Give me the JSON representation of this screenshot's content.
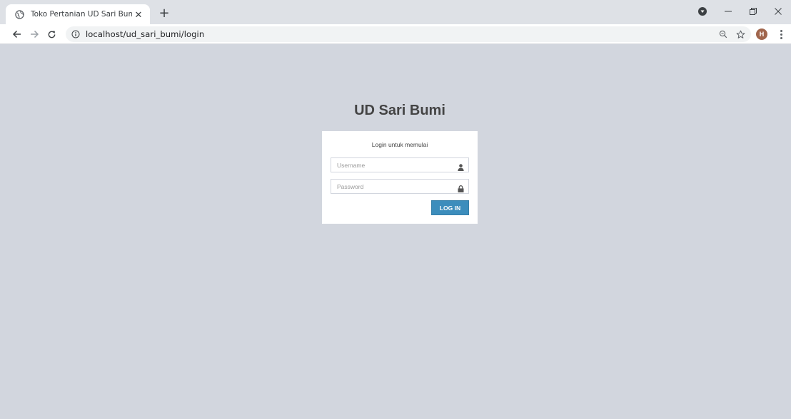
{
  "browser": {
    "tab_title": "Toko Pertanian UD Sari Bumi | Lo",
    "url": "localhost/ud_sari_bumi/login",
    "profile_initial": "H",
    "icons": [
      "globe-icon",
      "close-icon",
      "new-tab-icon",
      "back-icon",
      "forward-icon",
      "reload-icon",
      "info-icon",
      "zoom-icon",
      "star-icon",
      "menu-icon",
      "media-icon",
      "minimize-icon",
      "restore-icon",
      "window-close-icon"
    ]
  },
  "login": {
    "logo": "UD Sari Bumi",
    "message": "Login untuk memulai",
    "username_placeholder": "Username",
    "password_placeholder": "Password",
    "submit_label": "LOG IN",
    "accent_color": "#3c8dbc",
    "background_color": "#d2d6de"
  }
}
